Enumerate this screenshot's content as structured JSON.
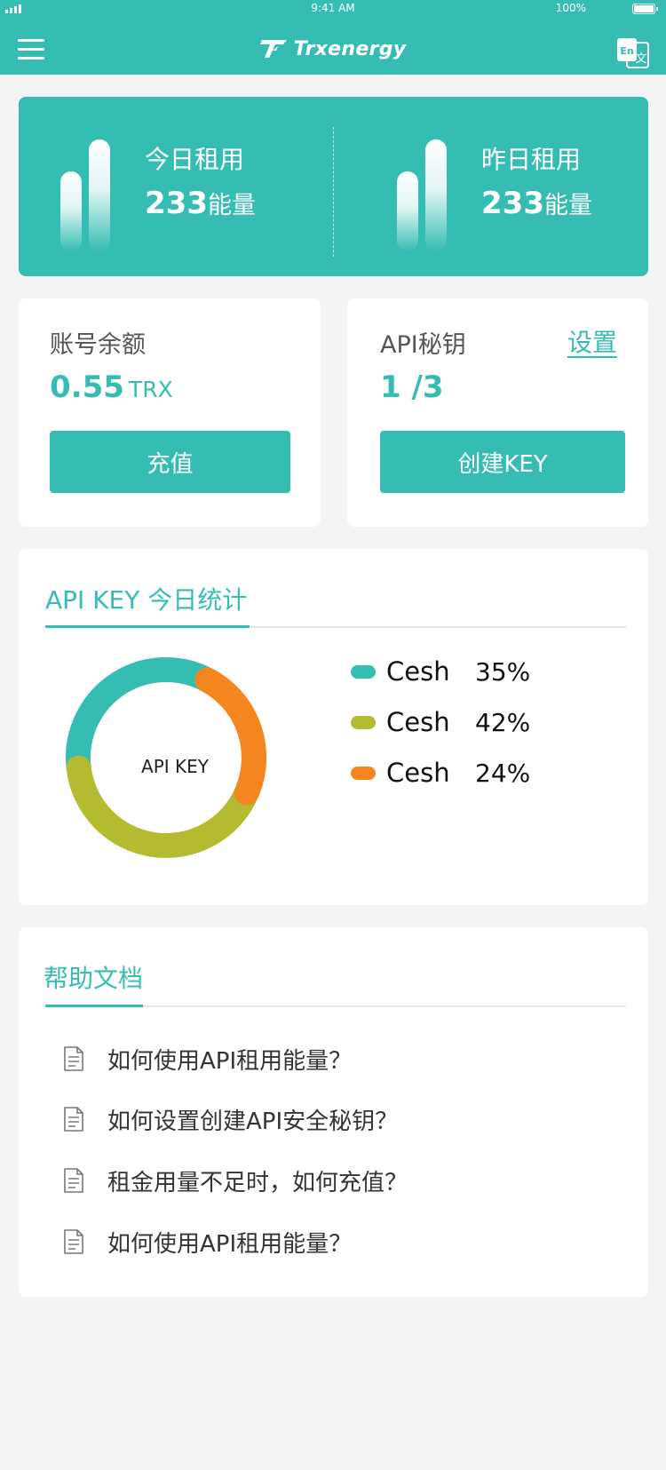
{
  "status_bar": {
    "time": "9:41 AM",
    "battery": "100%"
  },
  "header": {
    "brand": "Trxenergy",
    "menu_icon": "hamburger-menu-icon",
    "language_icon": "language-switch-icon",
    "lang_en": "En",
    "lang_zh": "文"
  },
  "energy": {
    "today": {
      "label": "今日租用",
      "value": "233",
      "unit": "能量"
    },
    "yesterday": {
      "label": "昨日租用",
      "value": "233",
      "unit": "能量"
    }
  },
  "balance": {
    "title": "账号余额",
    "value": "0.55",
    "unit": "TRX",
    "button": "充值"
  },
  "api_key": {
    "title": "API秘钥",
    "settings": "设置",
    "value": "1 /3",
    "button": "创建KEY"
  },
  "stats": {
    "tab": "API KEY  今日统计",
    "center_label": "API KEY"
  },
  "chart_data": {
    "type": "pie",
    "center_label": "API KEY",
    "series": [
      {
        "name": "Cesh",
        "value": 35,
        "label": "35%",
        "color": "#36bdb3"
      },
      {
        "name": "Cesh",
        "value": 42,
        "label": "42%",
        "color": "#b4bb30"
      },
      {
        "name": "Cesh",
        "value": 24,
        "label": "24%",
        "color": "#f5861f"
      }
    ]
  },
  "help": {
    "title": "帮助文档",
    "items": [
      "如何使用API租用能量？",
      "如何设置创建API安全秘钥？",
      "租金用量不足时，如何充值？",
      "如何使用API租用能量？"
    ]
  },
  "colors": {
    "primary": "#36bdb3",
    "background": "#f4f4f4"
  }
}
